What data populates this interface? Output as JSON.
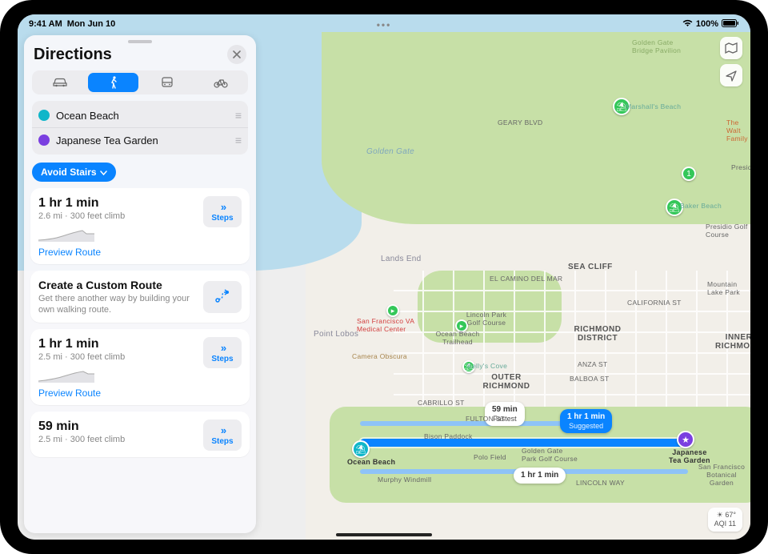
{
  "status": {
    "time": "9:41 AM",
    "date": "Mon Jun 10",
    "battery": "100%"
  },
  "sidebar": {
    "title": "Directions",
    "modes": [
      "drive",
      "walk",
      "transit",
      "bike"
    ],
    "from": "Ocean Beach",
    "to": "Japanese Tea Garden",
    "avoid": "Avoid Stairs",
    "steps_label": "Steps",
    "preview_label": "Preview Route",
    "custom": {
      "title": "Create a Custom Route",
      "subtitle": "Get there another way by building your own walking route."
    },
    "routes": [
      {
        "time": "1 hr 1 min",
        "detail": "2.6 mi · 300 feet climb"
      },
      {
        "time": "1 hr 1 min",
        "detail": "2.5 mi · 300 feet climb"
      },
      {
        "time": "59 min",
        "detail": "2.5 mi · 300 feet climb"
      }
    ]
  },
  "map": {
    "callouts": {
      "suggested": {
        "time": "1 hr 1 min",
        "tag": "Suggested"
      },
      "fastest": {
        "time": "59 min",
        "tag": "Fastest"
      },
      "alt": {
        "time": "1 hr 1 min"
      }
    },
    "dest_start": "Ocean Beach",
    "dest_end_l1": "Japanese",
    "dest_end_l2": "Tea Garden",
    "labels": {
      "golden_gate": "Golden Gate",
      "gg_bridge": "Golden Gate Bridge Pavilion",
      "marshalls": "Marshall's Beach",
      "walt": "The Walt Family",
      "presidio": "Presidio",
      "baker": "Baker Beach",
      "presidio_golf": "Presidio Golf Course",
      "lands_end": "Lands End",
      "sea_cliff": "SEA CLIFF",
      "camino": "EL CAMINO DEL MAR",
      "sfva": "San Francisco VA Medical Center",
      "lincoln_golf": "Lincoln Park Golf Course",
      "mountain_lake": "Mountain Lake Park",
      "geary": "GEARY BLVD",
      "california": "CALIFORNIA ST",
      "richmond": "RICHMOND DISTRICT",
      "inner_rich": "INNER RICHMOND",
      "pt_lobos": "Point Lobos",
      "camera": "Camera Obscura",
      "ob_trail": "Ocean Beach Trailhead",
      "kellys": "Kelly's Cove",
      "outer_rich": "OUTER RICHMOND",
      "anza": "ANZA ST",
      "balboa": "BALBOA ST",
      "cabrillo": "CABRILLO ST",
      "fulton": "FULTON ST",
      "bison": "Bison Paddock",
      "polo": "Polo Field",
      "ggp": "Golden Gate Park Golf Course",
      "murphy": "Murphy Windmill",
      "lincoln_way": "LINCOLN WAY",
      "sf_bot": "San Francisco Botanical Garden"
    },
    "weather": {
      "temp": "67°",
      "aqi": "AQI 11"
    }
  }
}
